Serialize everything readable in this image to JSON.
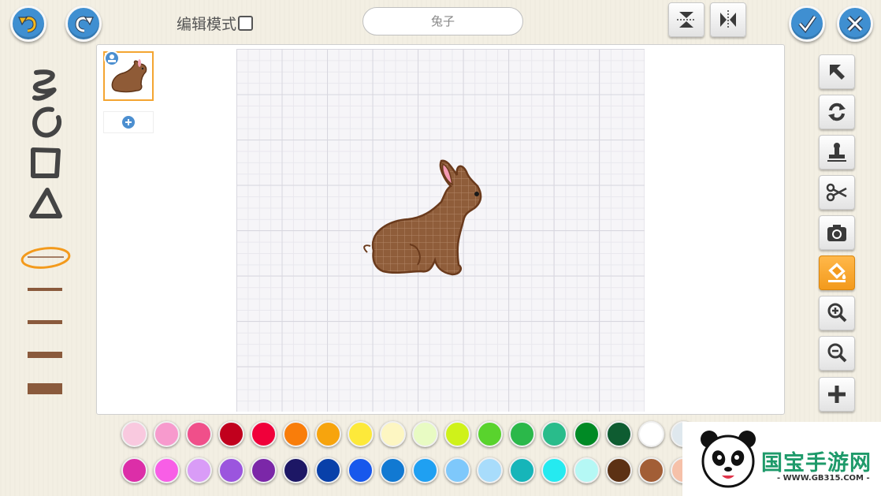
{
  "toolbar": {
    "edit_mode_label": "编辑模式",
    "sprite_name": "兔子",
    "accent_color": "#3f8fd1"
  },
  "left_tools": [
    "curve-icon",
    "ellipse-icon",
    "rectangle-icon",
    "triangle-icon",
    "selected-stroke-icon",
    "thin-line-icon",
    "medium-line-icon",
    "thick-line-icon",
    "thickest-line-icon"
  ],
  "right_tools": [
    "select-arrow-icon",
    "rotate-icon",
    "stamp-icon",
    "scissors-icon",
    "camera-icon",
    "paint-bucket-icon",
    "zoom-in-icon",
    "zoom-out-icon",
    "plus-icon"
  ],
  "active_right_tool": "paint-bucket-icon",
  "palette": {
    "row1": [
      "#f9c9df",
      "#f79acd",
      "#f04f8a",
      "#c1001d",
      "#f0003a",
      "#f97d0a",
      "#f7a40d",
      "#fde93a",
      "#fdf6c2",
      "#e8fbc3",
      "#cff21a",
      "#59d32d",
      "#2bb84a",
      "#29bc8b",
      "#008a25",
      "#0e5c31",
      "#ffffff",
      "#dfe8ee"
    ],
    "row2": [
      "#dc2ea8",
      "#f85ee6",
      "#d99cf7",
      "#9b55de",
      "#7b27a8",
      "#1d1765",
      "#0840a9",
      "#1758ec",
      "#1179d2",
      "#1fa0f2",
      "#7ec8fb",
      "#a8dcfb",
      "#16b5b9",
      "#25eaf0",
      "#b5f8f5",
      "#5c3114",
      "#a25e36",
      "#f6c1a9"
    ]
  },
  "watermark": {
    "title": "国宝手游网",
    "url": "- WWW.GB315.COM -"
  }
}
